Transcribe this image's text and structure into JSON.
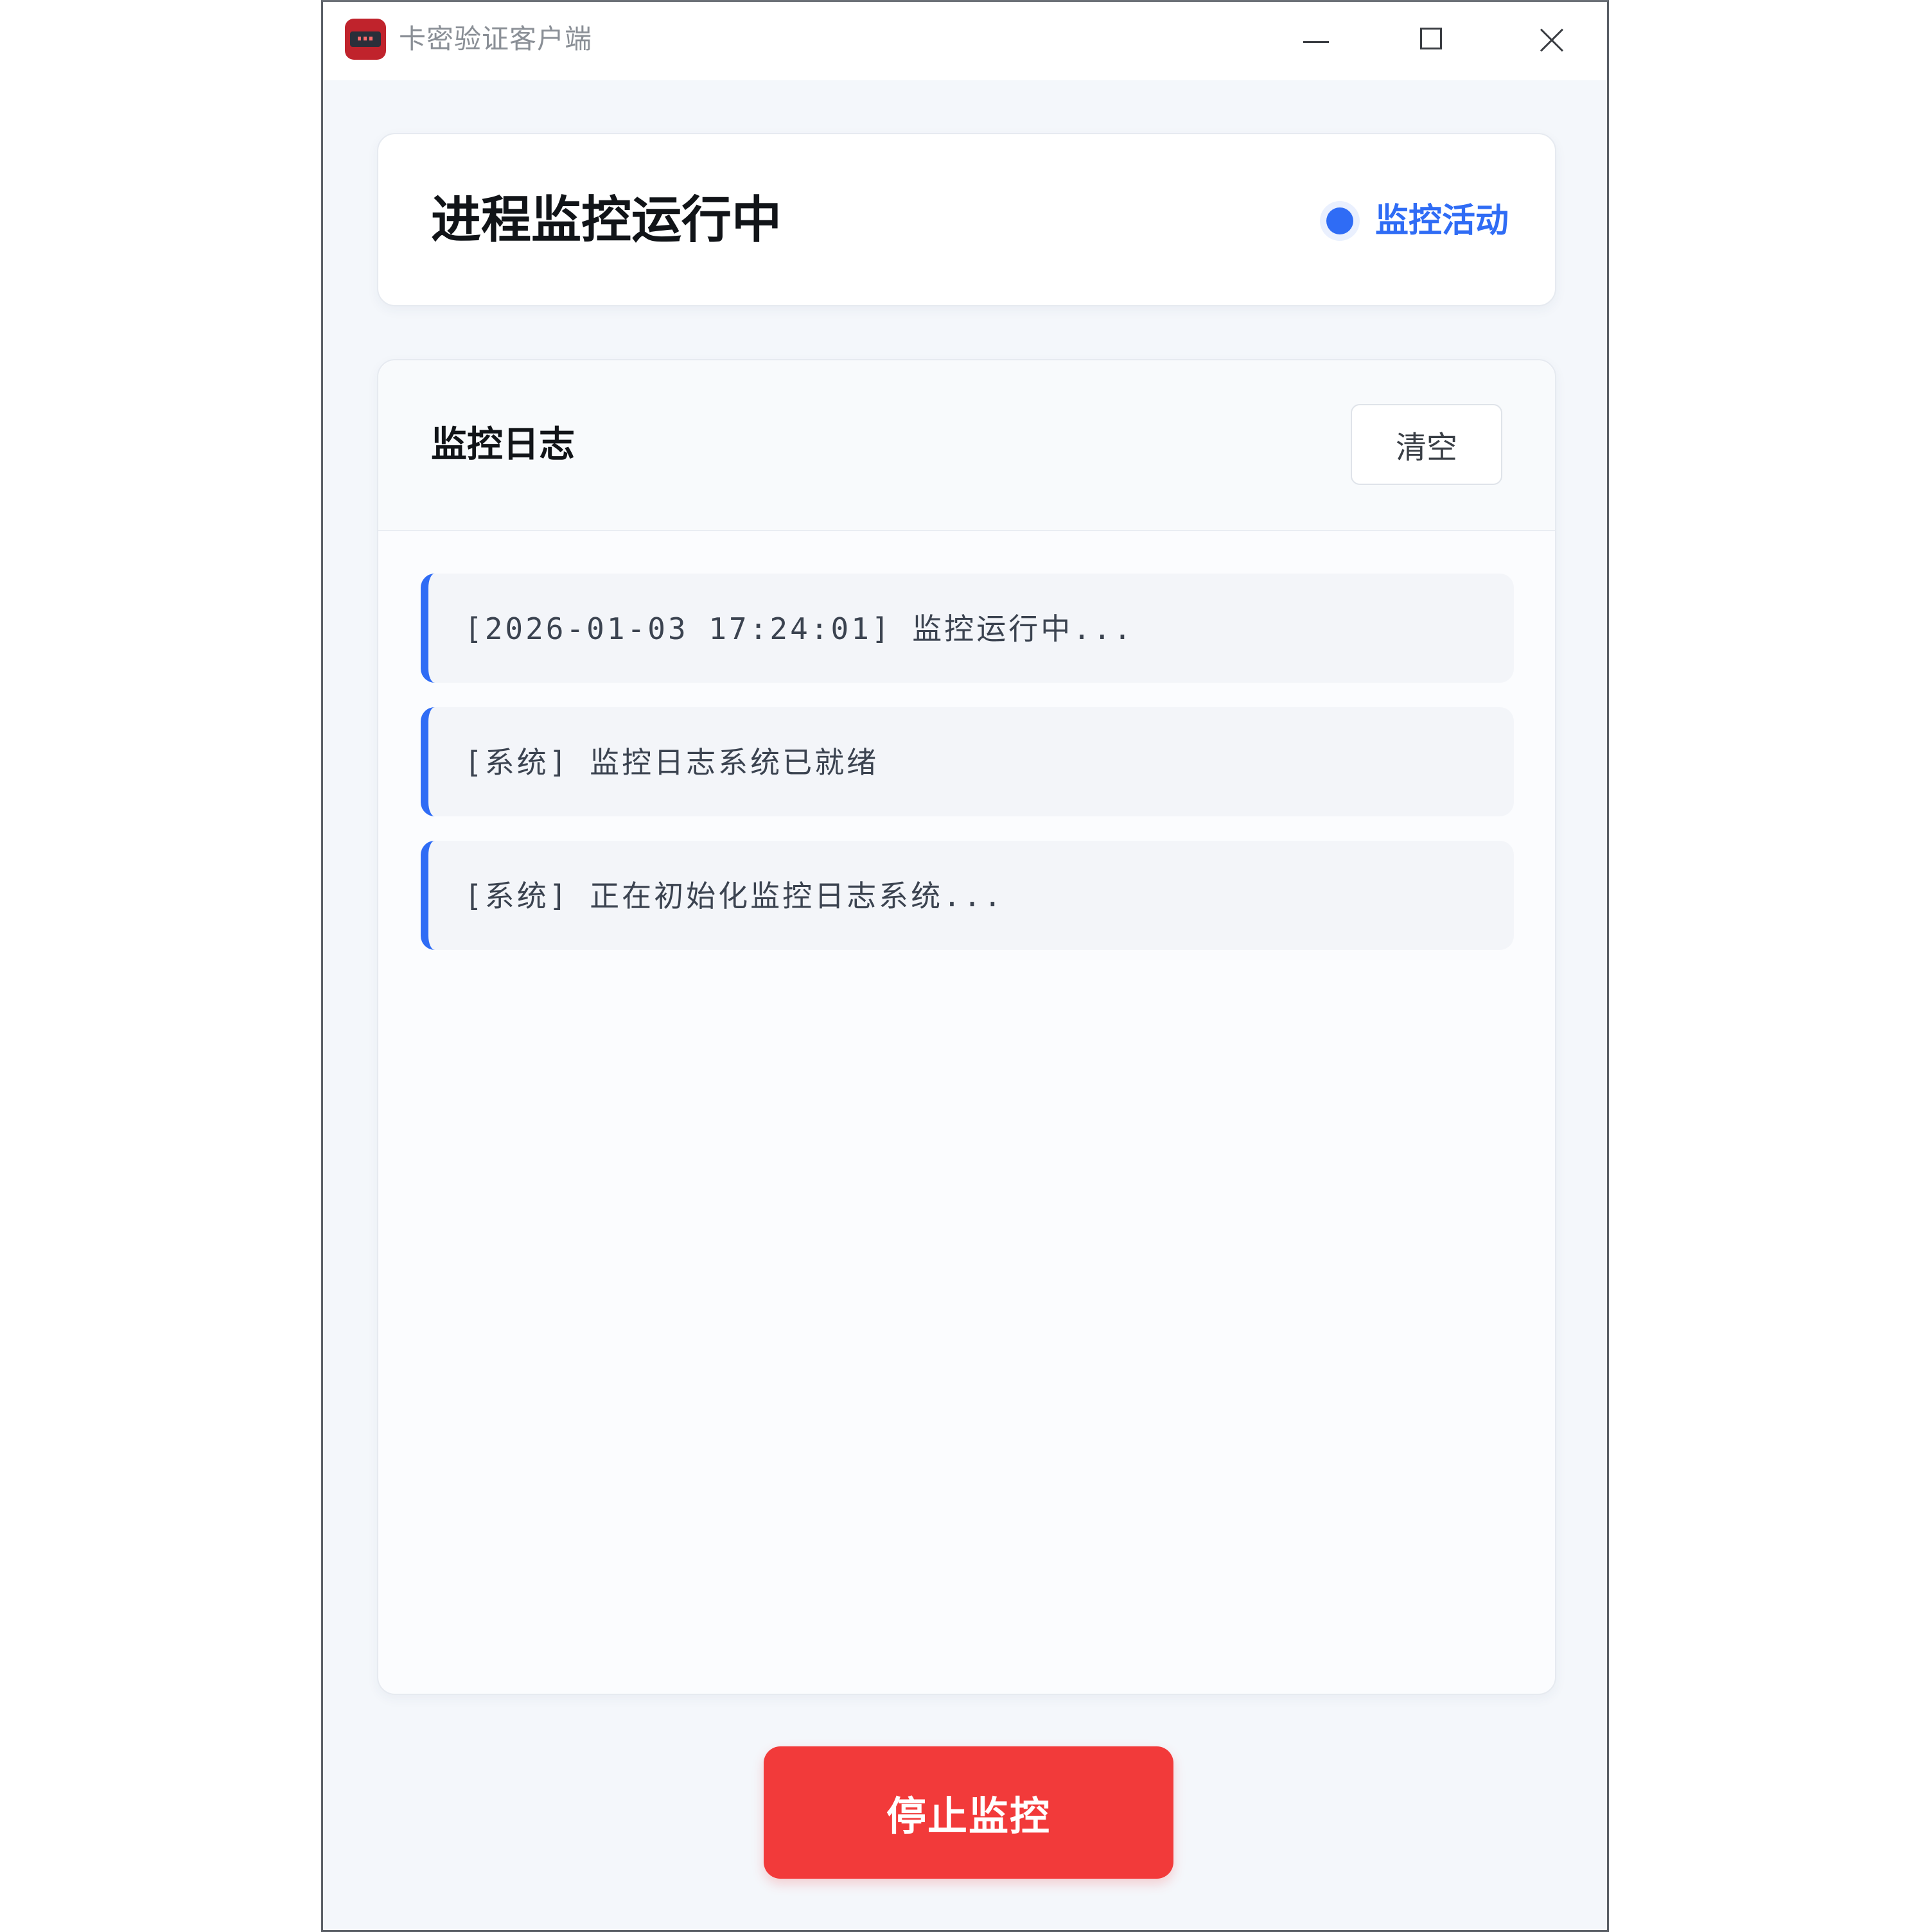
{
  "window": {
    "title": "卡密验证客户端"
  },
  "status": {
    "title": "进程监控运行中",
    "badge_label": "监控活动",
    "badge_color": "#2f6cf5"
  },
  "log_panel": {
    "title": "监控日志",
    "clear_label": "清空",
    "entries": [
      {
        "text": "[2026-01-03 17:24:01] 监控运行中..."
      },
      {
        "text": "[系统] 监控日志系统已就绪"
      },
      {
        "text": "[系统] 正在初始化监控日志系统..."
      }
    ]
  },
  "actions": {
    "stop_label": "停止监控",
    "stop_color": "#f23a3a"
  }
}
